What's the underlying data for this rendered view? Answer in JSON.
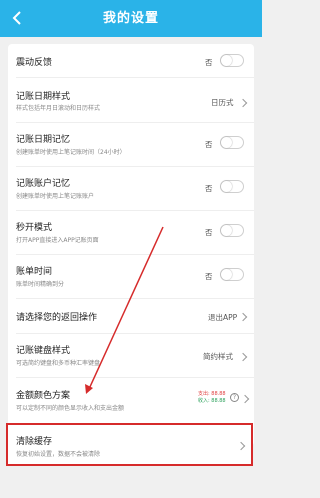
{
  "header": {
    "title": "我的设置"
  },
  "rows": {
    "vibration": {
      "title": "震动反馈",
      "value": "否"
    },
    "date_style": {
      "title": "记账日期样式",
      "subtitle": "样式包括年月日滚动和日历样式",
      "value": "日历式"
    },
    "date_memory": {
      "title": "记账日期记忆",
      "subtitle": "创建账单时使用上笔记账时间（24小时）",
      "value": "否"
    },
    "account_memory": {
      "title": "记账账户记忆",
      "subtitle": "创建账单时使用上笔记账账户",
      "value": "否"
    },
    "quick_open": {
      "title": "秒开模式",
      "subtitle": "打开APP直接进入APP记账页面",
      "value": "否"
    },
    "bill_time": {
      "title": "账单时间",
      "subtitle": "账单时间精确到分",
      "value": "否"
    },
    "back_action": {
      "title": "请选择您的返回操作",
      "value": "退出APP"
    },
    "keyboard_style": {
      "title": "记账键盘样式",
      "subtitle": "可选简约键盘和多币种汇率键盘",
      "value": "简约样式"
    },
    "amount_color": {
      "title": "金额颜色方案",
      "subtitle": "可以定制不同的颜色显示收入和支出金额",
      "expense": "支出: 88.88",
      "income": "收入: 88.88",
      "help": "?"
    },
    "clear_cache": {
      "title": "清除缓存",
      "subtitle": "恢复初始设置，数据不会被清除"
    }
  },
  "colors": {
    "header": "#2ab3e8",
    "highlight": "#d62b2b",
    "expense": "#e04040",
    "income": "#2aa05a"
  }
}
